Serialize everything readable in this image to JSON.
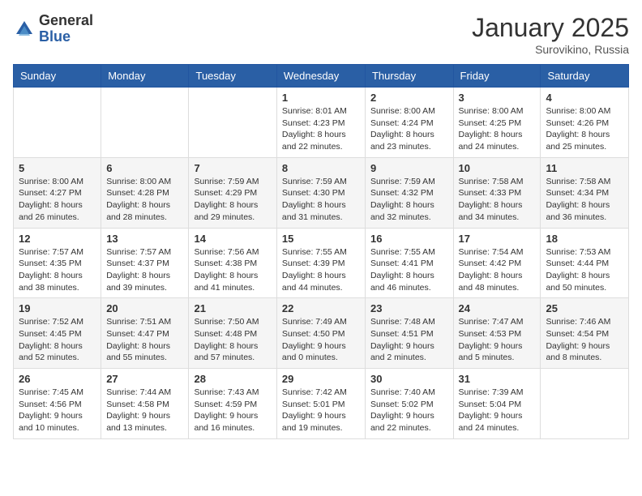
{
  "header": {
    "logo_general": "General",
    "logo_blue": "Blue",
    "month_title": "January 2025",
    "location": "Surovikino, Russia"
  },
  "days_of_week": [
    "Sunday",
    "Monday",
    "Tuesday",
    "Wednesday",
    "Thursday",
    "Friday",
    "Saturday"
  ],
  "weeks": [
    [
      {
        "day": "",
        "info": ""
      },
      {
        "day": "",
        "info": ""
      },
      {
        "day": "",
        "info": ""
      },
      {
        "day": "1",
        "info": "Sunrise: 8:01 AM\nSunset: 4:23 PM\nDaylight: 8 hours\nand 22 minutes."
      },
      {
        "day": "2",
        "info": "Sunrise: 8:00 AM\nSunset: 4:24 PM\nDaylight: 8 hours\nand 23 minutes."
      },
      {
        "day": "3",
        "info": "Sunrise: 8:00 AM\nSunset: 4:25 PM\nDaylight: 8 hours\nand 24 minutes."
      },
      {
        "day": "4",
        "info": "Sunrise: 8:00 AM\nSunset: 4:26 PM\nDaylight: 8 hours\nand 25 minutes."
      }
    ],
    [
      {
        "day": "5",
        "info": "Sunrise: 8:00 AM\nSunset: 4:27 PM\nDaylight: 8 hours\nand 26 minutes."
      },
      {
        "day": "6",
        "info": "Sunrise: 8:00 AM\nSunset: 4:28 PM\nDaylight: 8 hours\nand 28 minutes."
      },
      {
        "day": "7",
        "info": "Sunrise: 7:59 AM\nSunset: 4:29 PM\nDaylight: 8 hours\nand 29 minutes."
      },
      {
        "day": "8",
        "info": "Sunrise: 7:59 AM\nSunset: 4:30 PM\nDaylight: 8 hours\nand 31 minutes."
      },
      {
        "day": "9",
        "info": "Sunrise: 7:59 AM\nSunset: 4:32 PM\nDaylight: 8 hours\nand 32 minutes."
      },
      {
        "day": "10",
        "info": "Sunrise: 7:58 AM\nSunset: 4:33 PM\nDaylight: 8 hours\nand 34 minutes."
      },
      {
        "day": "11",
        "info": "Sunrise: 7:58 AM\nSunset: 4:34 PM\nDaylight: 8 hours\nand 36 minutes."
      }
    ],
    [
      {
        "day": "12",
        "info": "Sunrise: 7:57 AM\nSunset: 4:35 PM\nDaylight: 8 hours\nand 38 minutes."
      },
      {
        "day": "13",
        "info": "Sunrise: 7:57 AM\nSunset: 4:37 PM\nDaylight: 8 hours\nand 39 minutes."
      },
      {
        "day": "14",
        "info": "Sunrise: 7:56 AM\nSunset: 4:38 PM\nDaylight: 8 hours\nand 41 minutes."
      },
      {
        "day": "15",
        "info": "Sunrise: 7:55 AM\nSunset: 4:39 PM\nDaylight: 8 hours\nand 44 minutes."
      },
      {
        "day": "16",
        "info": "Sunrise: 7:55 AM\nSunset: 4:41 PM\nDaylight: 8 hours\nand 46 minutes."
      },
      {
        "day": "17",
        "info": "Sunrise: 7:54 AM\nSunset: 4:42 PM\nDaylight: 8 hours\nand 48 minutes."
      },
      {
        "day": "18",
        "info": "Sunrise: 7:53 AM\nSunset: 4:44 PM\nDaylight: 8 hours\nand 50 minutes."
      }
    ],
    [
      {
        "day": "19",
        "info": "Sunrise: 7:52 AM\nSunset: 4:45 PM\nDaylight: 8 hours\nand 52 minutes."
      },
      {
        "day": "20",
        "info": "Sunrise: 7:51 AM\nSunset: 4:47 PM\nDaylight: 8 hours\nand 55 minutes."
      },
      {
        "day": "21",
        "info": "Sunrise: 7:50 AM\nSunset: 4:48 PM\nDaylight: 8 hours\nand 57 minutes."
      },
      {
        "day": "22",
        "info": "Sunrise: 7:49 AM\nSunset: 4:50 PM\nDaylight: 9 hours\nand 0 minutes."
      },
      {
        "day": "23",
        "info": "Sunrise: 7:48 AM\nSunset: 4:51 PM\nDaylight: 9 hours\nand 2 minutes."
      },
      {
        "day": "24",
        "info": "Sunrise: 7:47 AM\nSunset: 4:53 PM\nDaylight: 9 hours\nand 5 minutes."
      },
      {
        "day": "25",
        "info": "Sunrise: 7:46 AM\nSunset: 4:54 PM\nDaylight: 9 hours\nand 8 minutes."
      }
    ],
    [
      {
        "day": "26",
        "info": "Sunrise: 7:45 AM\nSunset: 4:56 PM\nDaylight: 9 hours\nand 10 minutes."
      },
      {
        "day": "27",
        "info": "Sunrise: 7:44 AM\nSunset: 4:58 PM\nDaylight: 9 hours\nand 13 minutes."
      },
      {
        "day": "28",
        "info": "Sunrise: 7:43 AM\nSunset: 4:59 PM\nDaylight: 9 hours\nand 16 minutes."
      },
      {
        "day": "29",
        "info": "Sunrise: 7:42 AM\nSunset: 5:01 PM\nDaylight: 9 hours\nand 19 minutes."
      },
      {
        "day": "30",
        "info": "Sunrise: 7:40 AM\nSunset: 5:02 PM\nDaylight: 9 hours\nand 22 minutes."
      },
      {
        "day": "31",
        "info": "Sunrise: 7:39 AM\nSunset: 5:04 PM\nDaylight: 9 hours\nand 24 minutes."
      },
      {
        "day": "",
        "info": ""
      }
    ]
  ]
}
